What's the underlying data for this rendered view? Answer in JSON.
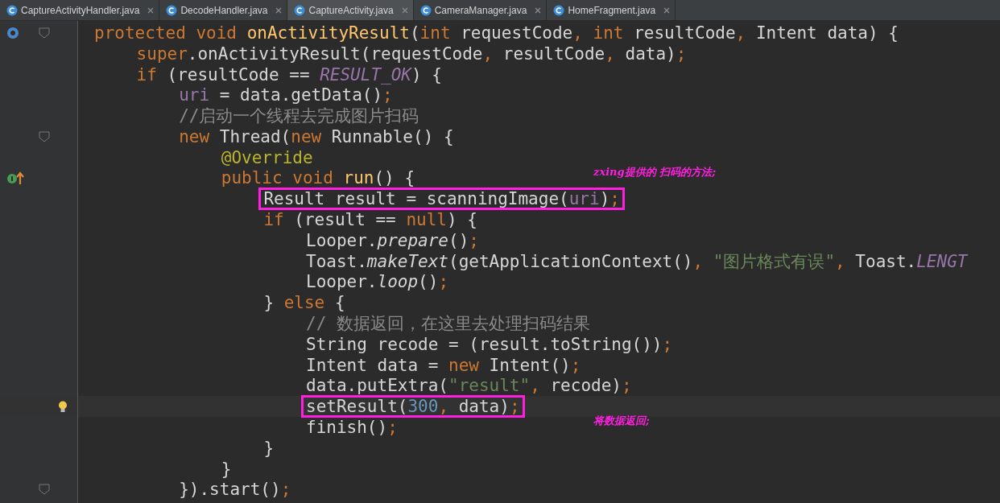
{
  "tabs": [
    {
      "label": "CaptureActivityHandler.java",
      "selected": false
    },
    {
      "label": "DecodeHandler.java",
      "selected": false
    },
    {
      "label": "CaptureActivity.java",
      "selected": true
    },
    {
      "label": "CameraManager.java",
      "selected": false
    },
    {
      "label": "HomeFragment.java",
      "selected": false
    }
  ],
  "code_lines": [
    {
      "kind": "override",
      "folded": false,
      "tokens": [
        {
          "text": "protected void ",
          "kind": "keyword"
        },
        {
          "text": "onActivityResult",
          "kind": "method"
        },
        {
          "text": "(",
          "kind": "plain"
        },
        {
          "text": "int ",
          "kind": "keyword"
        },
        {
          "text": "requestCode",
          "kind": "plain"
        },
        {
          "text": ", ",
          "kind": "keyword"
        },
        {
          "text": "int ",
          "kind": "keyword"
        },
        {
          "text": "resultCode",
          "kind": "plain"
        },
        {
          "text": ", ",
          "kind": "keyword"
        },
        {
          "text": "Intent data) {",
          "kind": "plain"
        }
      ],
      "children": [
        {
          "kind": "code",
          "tokens": [
            {
              "text": "super",
              "kind": "keyword"
            },
            {
              "text": ".onActivityResult(requestCode",
              "kind": "plain"
            },
            {
              "text": ", ",
              "kind": "keyword"
            },
            {
              "text": "resultCode",
              "kind": "plain"
            },
            {
              "text": ", ",
              "kind": "keyword"
            },
            {
              "text": "data)",
              "kind": "plain"
            },
            {
              "text": ";",
              "kind": "keyword"
            }
          ]
        },
        {
          "kind": "code",
          "tokens": [
            {
              "text": "if ",
              "kind": "keyword"
            },
            {
              "text": "(resultCode == ",
              "kind": "plain"
            },
            {
              "text": "RESULT_OK",
              "kind": "constant"
            },
            {
              "text": ") {",
              "kind": "plain"
            }
          ],
          "children": [
            {
              "kind": "code",
              "tokens": [
                {
                  "text": "uri",
                  "kind": "field"
                },
                {
                  "text": " = data.getData()",
                  "kind": "plain"
                },
                {
                  "text": ";",
                  "kind": "keyword"
                }
              ]
            },
            {
              "kind": "code",
              "tokens": [
                {
                  "text": "//启动一个线程去完成图片扫码",
                  "kind": "comment"
                }
              ]
            },
            {
              "kind": "code",
              "folded": false,
              "tokens": [
                {
                  "text": "new ",
                  "kind": "keyword"
                },
                {
                  "text": "Thread(",
                  "kind": "plain"
                },
                {
                  "text": "new ",
                  "kind": "keyword"
                },
                {
                  "text": "Runnable() {",
                  "kind": "plain"
                }
              ],
              "children": [
                {
                  "kind": "code",
                  "tokens": [
                    {
                      "text": "@Override",
                      "kind": "annotation"
                    }
                  ]
                },
                {
                  "kind": "implements",
                  "note": "zxing提供的 扫码的方法;",
                  "tokens": [
                    {
                      "text": "public void ",
                      "kind": "keyword"
                    },
                    {
                      "text": "run",
                      "kind": "method"
                    },
                    {
                      "text": "() {",
                      "kind": "plain"
                    }
                  ],
                  "children": [
                    {
                      "kind": "code",
                      "boxed": true,
                      "tokens": [
                        {
                          "text": "Result result = scanningImage(",
                          "kind": "plain"
                        },
                        {
                          "text": "uri",
                          "kind": "field"
                        },
                        {
                          "text": ")",
                          "kind": "plain"
                        },
                        {
                          "text": ";",
                          "kind": "keyword"
                        }
                      ]
                    },
                    {
                      "kind": "code",
                      "tokens": [
                        {
                          "text": "if ",
                          "kind": "keyword"
                        },
                        {
                          "text": "(result == ",
                          "kind": "plain"
                        },
                        {
                          "text": "null",
                          "kind": "keyword"
                        },
                        {
                          "text": ") {",
                          "kind": "plain"
                        }
                      ],
                      "children": [
                        {
                          "kind": "code",
                          "tokens": [
                            {
                              "text": "Looper.",
                              "kind": "plain"
                            },
                            {
                              "text": "prepare",
                              "kind": "static"
                            },
                            {
                              "text": "()",
                              "kind": "plain"
                            },
                            {
                              "text": ";",
                              "kind": "keyword"
                            }
                          ]
                        },
                        {
                          "kind": "code",
                          "tokens": [
                            {
                              "text": "Toast.",
                              "kind": "plain"
                            },
                            {
                              "text": "makeText",
                              "kind": "static"
                            },
                            {
                              "text": "(getApplicationContext()",
                              "kind": "plain"
                            },
                            {
                              "text": ", ",
                              "kind": "keyword"
                            },
                            {
                              "text": "\"图片格式有误\"",
                              "kind": "string"
                            },
                            {
                              "text": ", ",
                              "kind": "keyword"
                            },
                            {
                              "text": "Toast.",
                              "kind": "plain"
                            },
                            {
                              "text": "LENGT",
                              "kind": "constant"
                            }
                          ]
                        },
                        {
                          "kind": "code",
                          "tokens": [
                            {
                              "text": "Looper.",
                              "kind": "plain"
                            },
                            {
                              "text": "loop",
                              "kind": "static"
                            },
                            {
                              "text": "()",
                              "kind": "plain"
                            },
                            {
                              "text": ";",
                              "kind": "keyword"
                            }
                          ]
                        }
                      ]
                    },
                    {
                      "kind": "code",
                      "tokens": [
                        {
                          "text": "} ",
                          "kind": "plain"
                        },
                        {
                          "text": "else ",
                          "kind": "keyword"
                        },
                        {
                          "text": "{",
                          "kind": "plain"
                        }
                      ],
                      "children": [
                        {
                          "kind": "code",
                          "tokens": [
                            {
                              "text": "// 数据返回，在这里去处理扫码结果",
                              "kind": "comment"
                            }
                          ]
                        },
                        {
                          "kind": "code",
                          "tokens": [
                            {
                              "text": "String recode = (result.toString())",
                              "kind": "plain"
                            },
                            {
                              "text": ";",
                              "kind": "keyword"
                            }
                          ]
                        },
                        {
                          "kind": "code",
                          "tokens": [
                            {
                              "text": "Intent data = ",
                              "kind": "plain"
                            },
                            {
                              "text": "new ",
                              "kind": "keyword"
                            },
                            {
                              "text": "Intent()",
                              "kind": "plain"
                            },
                            {
                              "text": ";",
                              "kind": "keyword"
                            }
                          ]
                        },
                        {
                          "kind": "code",
                          "tokens": [
                            {
                              "text": "data.putExtra(",
                              "kind": "plain"
                            },
                            {
                              "text": "\"result\"",
                              "kind": "string"
                            },
                            {
                              "text": ", ",
                              "kind": "keyword"
                            },
                            {
                              "text": "recode)",
                              "kind": "plain"
                            },
                            {
                              "text": ";",
                              "kind": "keyword"
                            }
                          ]
                        },
                        {
                          "kind": "hint",
                          "boxed": true,
                          "current": true,
                          "tokens": [
                            {
                              "text": "setResult(",
                              "kind": "plain"
                            },
                            {
                              "text": "300",
                              "kind": "number"
                            },
                            {
                              "text": ", ",
                              "kind": "keyword"
                            },
                            {
                              "text": "data)",
                              "kind": "plain"
                            },
                            {
                              "text": ";",
                              "kind": "keyword"
                            }
                          ]
                        },
                        {
                          "kind": "code",
                          "note": "将数据返回;",
                          "tokens": [
                            {
                              "text": "finish()",
                              "kind": "plain"
                            },
                            {
                              "text": ";",
                              "kind": "keyword"
                            }
                          ]
                        }
                      ]
                    },
                    {
                      "kind": "code",
                      "tokens": [
                        {
                          "text": "}",
                          "kind": "plain"
                        }
                      ]
                    }
                  ]
                },
                {
                  "kind": "code",
                  "tokens": [
                    {
                      "text": "}",
                      "kind": "plain"
                    }
                  ]
                }
              ]
            },
            {
              "kind": "code",
              "folded": false,
              "tokens": [
                {
                  "text": "}).start()",
                  "kind": "plain"
                },
                {
                  "text": ";",
                  "kind": "keyword"
                }
              ]
            }
          ]
        }
      ]
    }
  ]
}
